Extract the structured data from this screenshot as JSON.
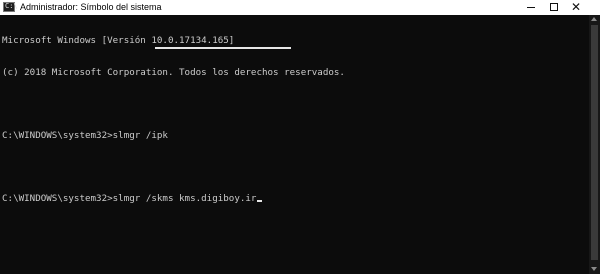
{
  "window": {
    "title": "Administrador: Símbolo del sistema",
    "icon_glyph": "C:\\",
    "controls": {
      "minimize": "minimize-icon",
      "maximize": "maximize-icon",
      "close": "close-icon",
      "close_glyph": "✕"
    }
  },
  "console": {
    "lines": [
      "Microsoft Windows [Versión 10.0.17134.165]",
      "(c) 2018 Microsoft Corporation. Todos los derechos reservados.",
      "",
      "C:\\WINDOWS\\system32>slmgr /ipk ",
      "",
      "C:\\WINDOWS\\system32>slmgr /skms kms.digiboy.ir"
    ],
    "redacted_key": "redaction-bar",
    "cursor": "blinking-underline-cursor"
  },
  "colors": {
    "background": "#0c0c0c",
    "text": "#cccccc",
    "titlebar": "#ffffff"
  }
}
